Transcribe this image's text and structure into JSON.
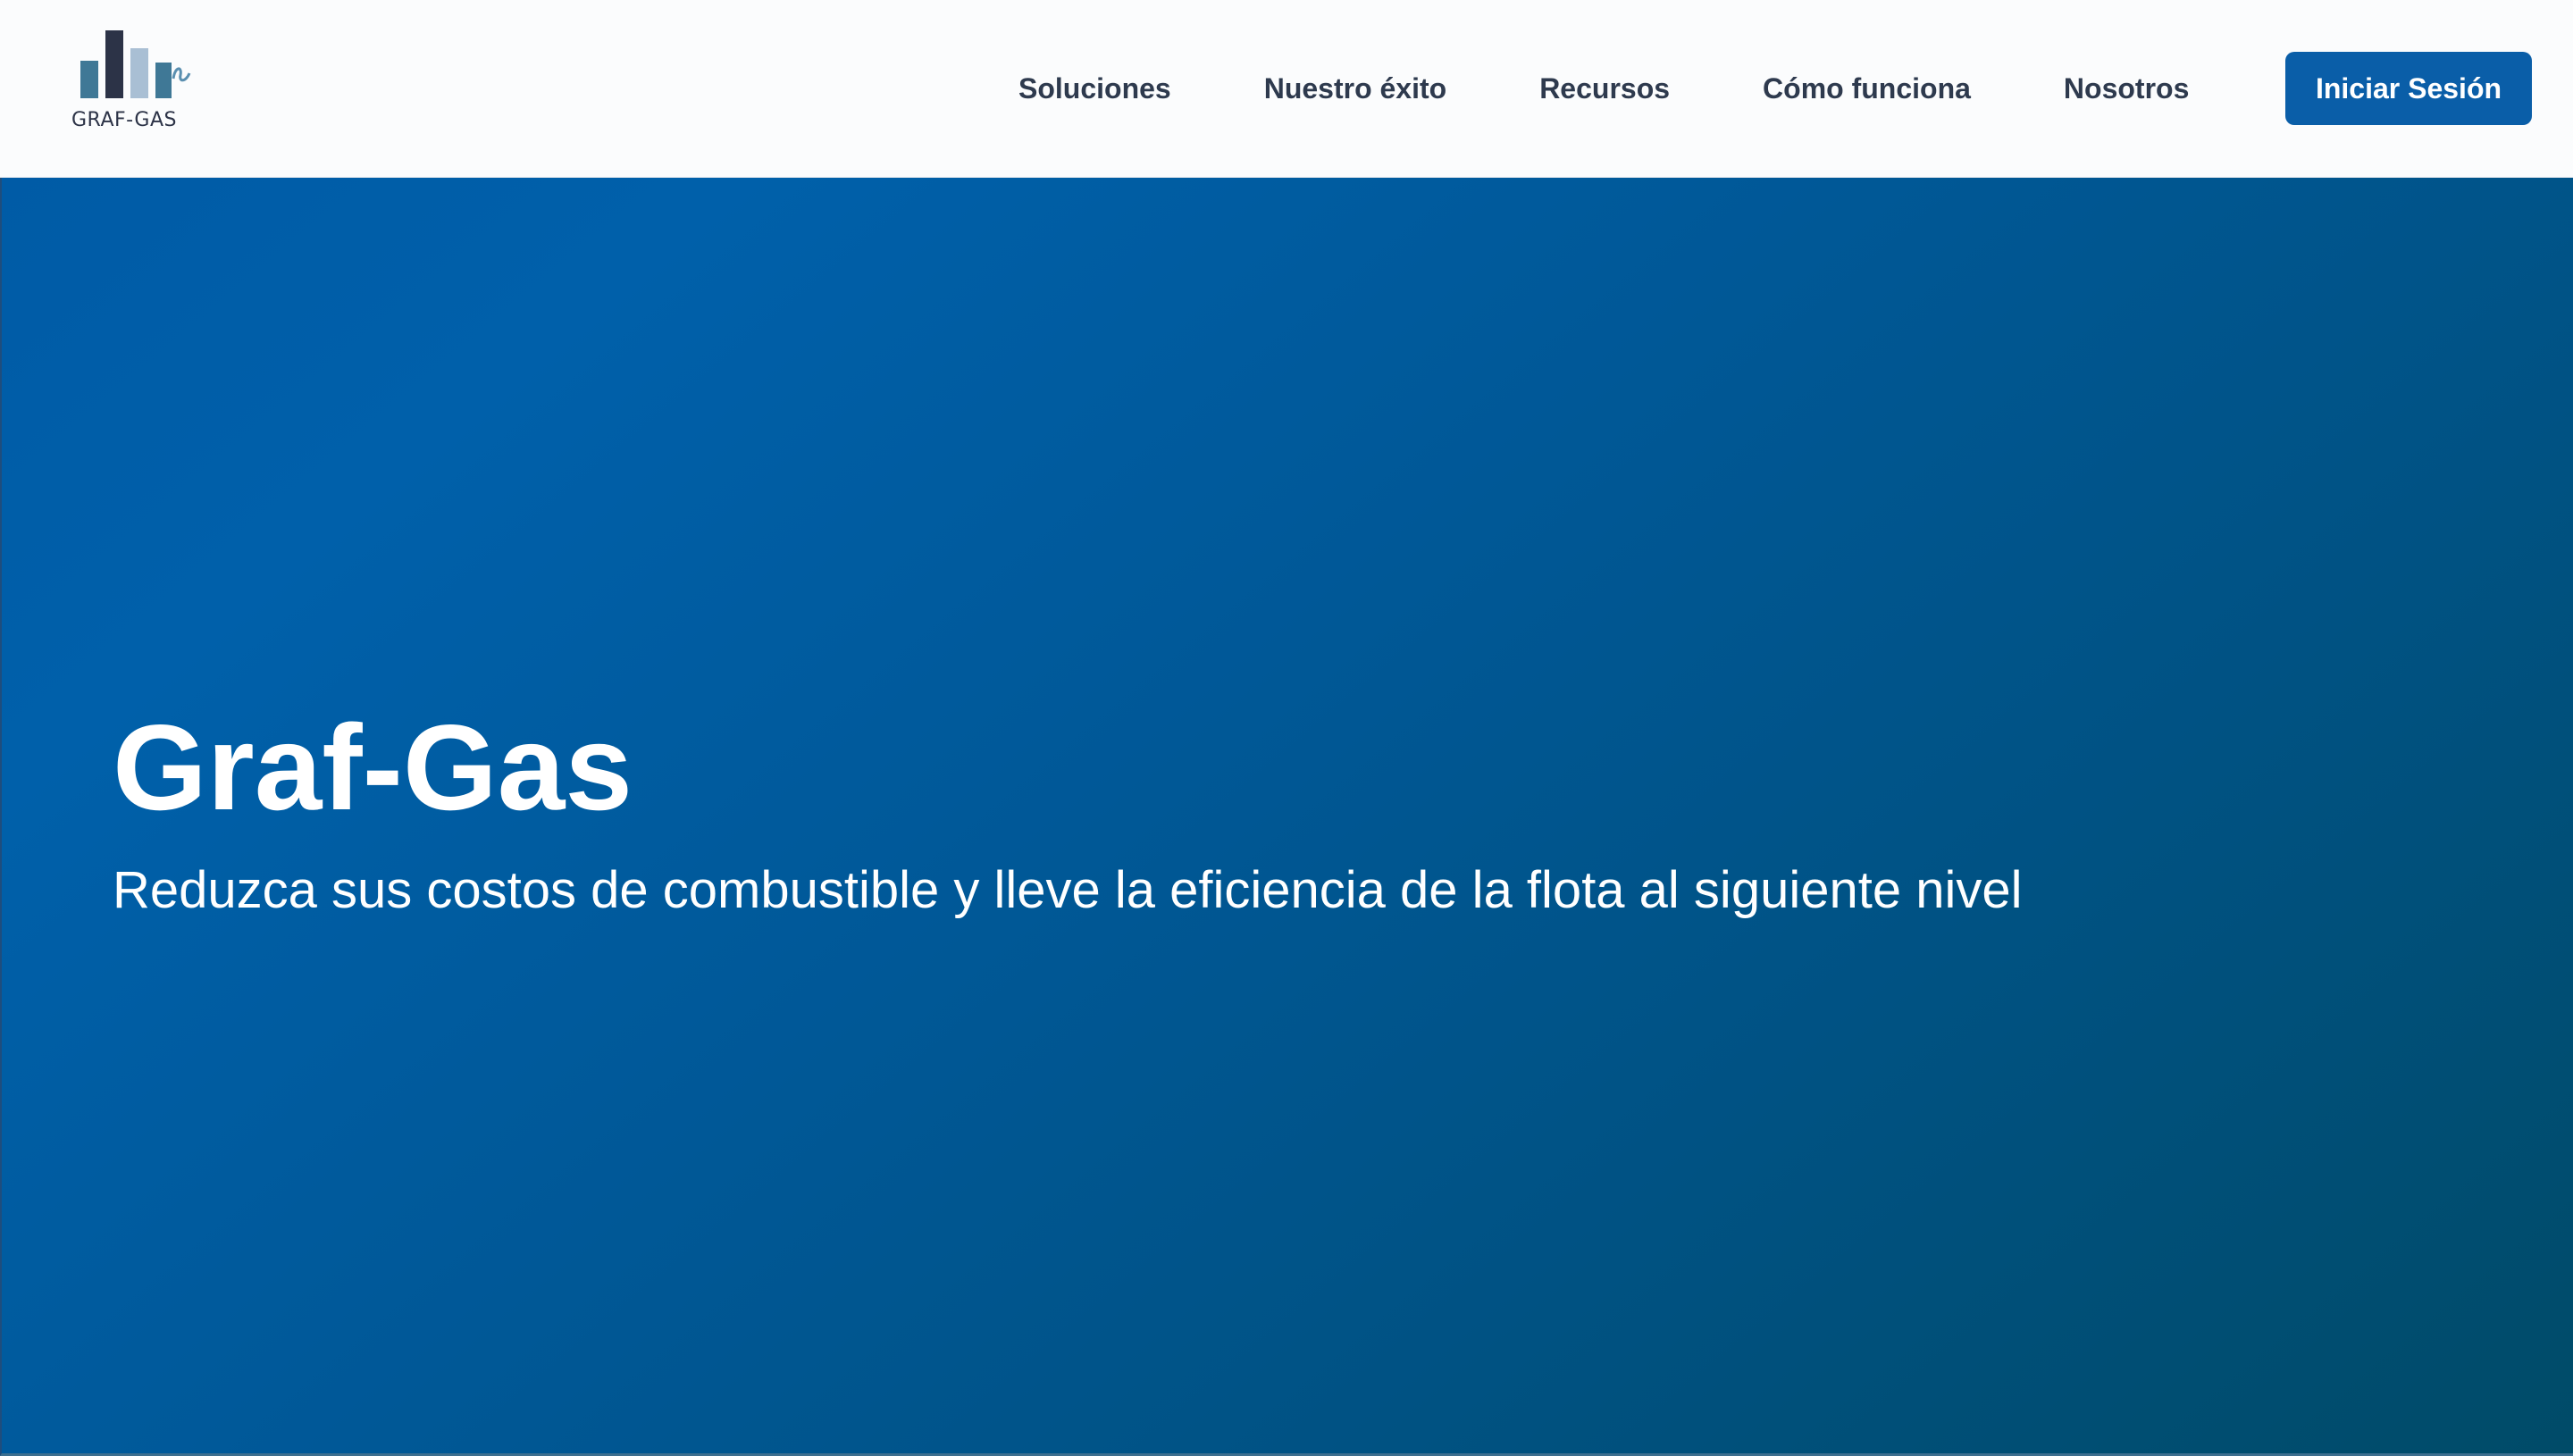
{
  "brand": {
    "logo_text": "GRAF-GAS",
    "logo_colors": [
      "#3f7896",
      "#2c3347",
      "#a9bfd4",
      "#3f7896"
    ]
  },
  "nav": {
    "items": [
      {
        "label": "Soluciones"
      },
      {
        "label": "Nuestro éxito"
      },
      {
        "label": "Recursos"
      },
      {
        "label": "Cómo funciona"
      },
      {
        "label": "Nosotros"
      }
    ],
    "login_label": "Iniciar Sesión"
  },
  "hero": {
    "title": "Graf-Gas",
    "subtitle": "Reduzca sus costos de combustible y lleve la eficiencia de la flota al siguiente nivel"
  },
  "colors": {
    "primary": "#0a5ea8",
    "hero_gradient_start": "#005ba6",
    "hero_gradient_end": "#004b68",
    "nav_text": "#2e3a4e"
  }
}
